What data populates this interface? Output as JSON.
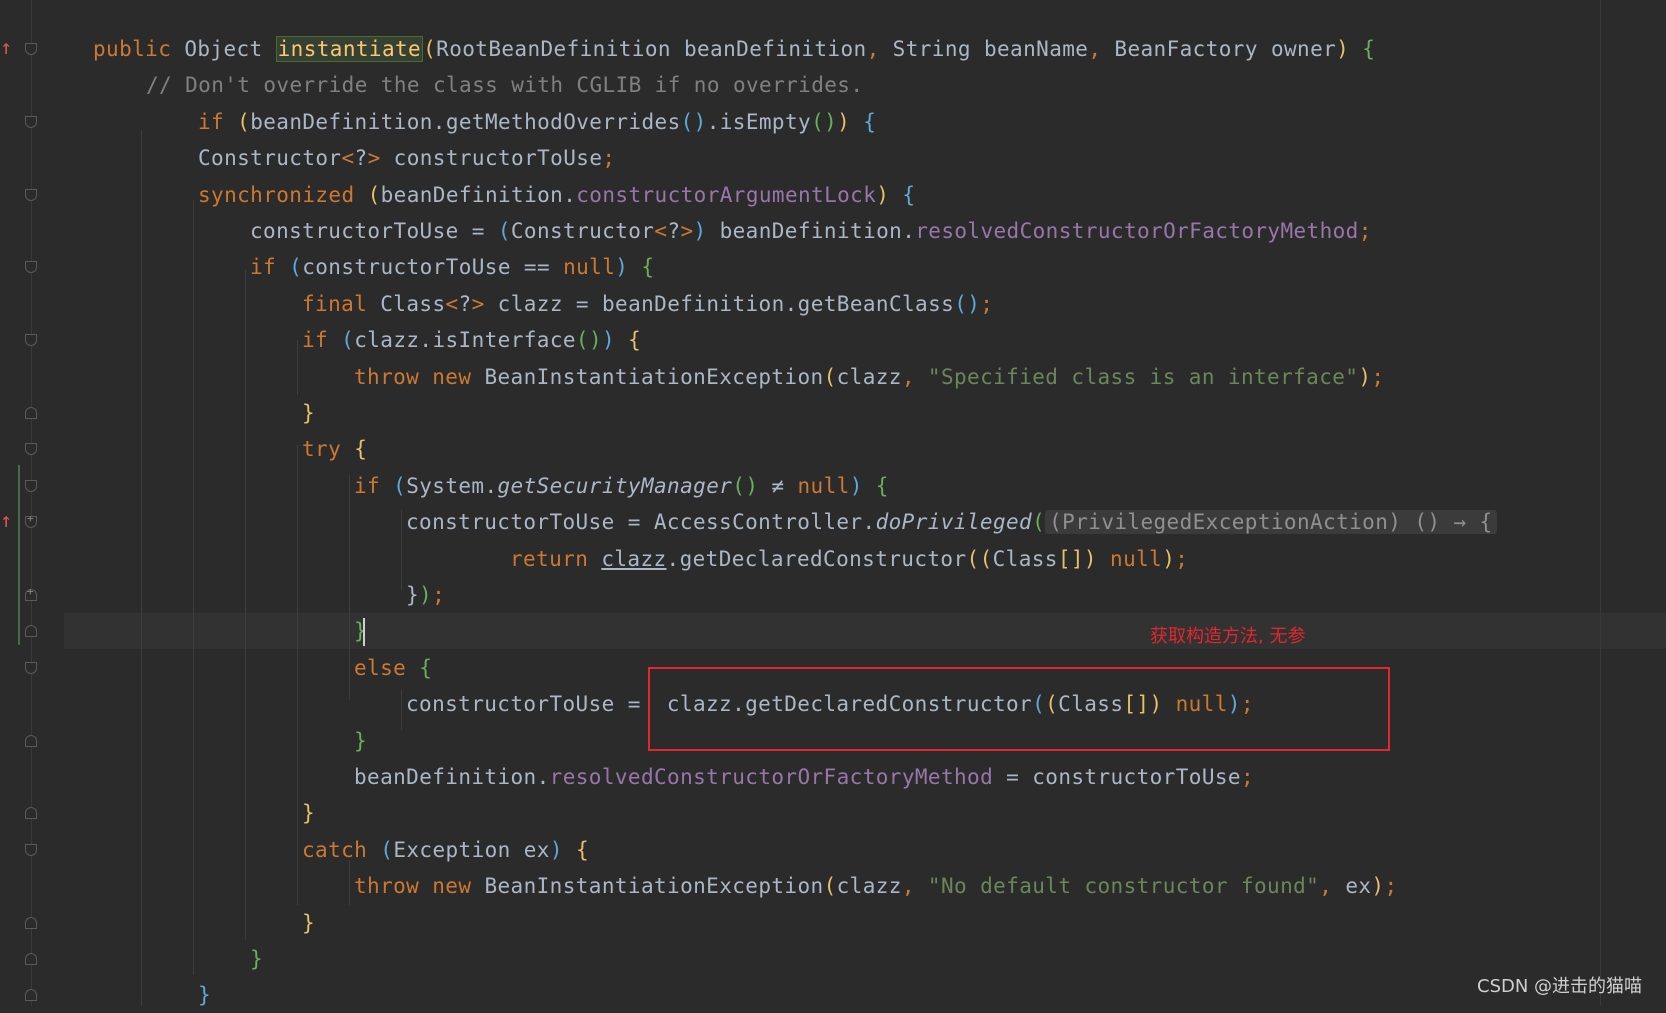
{
  "code_lines": [
    [
      {
        "c": "kw",
        "t": "public "
      },
      {
        "t": "Object "
      },
      {
        "c": "hl",
        "t": "instantiate"
      },
      {
        "c": "b1",
        "t": "("
      },
      {
        "t": "RootBeanDefinition beanDefinition"
      },
      {
        "c": "kw",
        "t": ", "
      },
      {
        "t": "String beanName"
      },
      {
        "c": "kw",
        "t": ", "
      },
      {
        "t": "BeanFactory owner"
      },
      {
        "c": "b1",
        "t": ")"
      },
      {
        "t": " "
      },
      {
        "c": "b3",
        "t": "{"
      }
    ],
    [
      {
        "c": "cmt",
        "t": "// Don't override the class with CGLIB if no overrides."
      }
    ],
    [
      {
        "c": "kw",
        "t": "if "
      },
      {
        "c": "b1",
        "t": "("
      },
      {
        "t": "beanDefinition.getMethodOverrides"
      },
      {
        "c": "b2",
        "t": "()"
      },
      {
        "t": ".isEmpty"
      },
      {
        "c": "b3",
        "t": "()"
      },
      {
        "c": "b1",
        "t": ")"
      },
      {
        "t": " "
      },
      {
        "c": "b2",
        "t": "{"
      }
    ],
    [
      {
        "t": "Constructor"
      },
      {
        "c": "kw",
        "t": "<"
      },
      {
        "t": "?"
      },
      {
        "c": "kw",
        "t": ">"
      },
      {
        "t": " constructorToUse"
      },
      {
        "c": "kw",
        "t": ";"
      }
    ],
    [
      {
        "c": "kw",
        "t": "synchronized "
      },
      {
        "c": "b1",
        "t": "("
      },
      {
        "t": "beanDefinition."
      },
      {
        "c": "fld",
        "t": "constructorArgumentLock"
      },
      {
        "c": "b1",
        "t": ")"
      },
      {
        "t": " "
      },
      {
        "c": "b2",
        "t": "{"
      }
    ],
    [
      {
        "t": "constructorToUse = "
      },
      {
        "c": "b2",
        "t": "("
      },
      {
        "t": "Constructor"
      },
      {
        "c": "kw",
        "t": "<"
      },
      {
        "t": "?"
      },
      {
        "c": "kw",
        "t": ">"
      },
      {
        "c": "b2",
        "t": ")"
      },
      {
        "t": " beanDefinition."
      },
      {
        "c": "fld",
        "t": "resolvedConstructorOrFactoryMethod"
      },
      {
        "c": "kw",
        "t": ";"
      }
    ],
    [
      {
        "c": "kw",
        "t": "if "
      },
      {
        "c": "b2",
        "t": "("
      },
      {
        "t": "constructorToUse == "
      },
      {
        "c": "kw",
        "t": "null"
      },
      {
        "c": "b2",
        "t": ")"
      },
      {
        "t": " "
      },
      {
        "c": "b3",
        "t": "{"
      }
    ],
    [
      {
        "c": "kw",
        "t": "final "
      },
      {
        "t": "Class"
      },
      {
        "c": "kw",
        "t": "<"
      },
      {
        "t": "?"
      },
      {
        "c": "kw",
        "t": ">"
      },
      {
        "t": " clazz = beanDefinition.getBeanClass"
      },
      {
        "c": "b2",
        "t": "()"
      },
      {
        "c": "kw",
        "t": ";"
      }
    ],
    [
      {
        "c": "kw",
        "t": "if "
      },
      {
        "c": "b2",
        "t": "("
      },
      {
        "t": "clazz.isInterface"
      },
      {
        "c": "b3",
        "t": "()"
      },
      {
        "c": "b2",
        "t": ")"
      },
      {
        "t": " "
      },
      {
        "c": "b1",
        "t": "{"
      }
    ],
    [
      {
        "c": "kw",
        "t": "throw new "
      },
      {
        "t": "BeanInstantiationException"
      },
      {
        "c": "b1",
        "t": "("
      },
      {
        "t": "clazz"
      },
      {
        "c": "kw",
        "t": ", "
      },
      {
        "c": "str",
        "t": "\"Specified class is an interface\""
      },
      {
        "c": "b1",
        "t": ")"
      },
      {
        "c": "kw",
        "t": ";"
      }
    ],
    [
      {
        "c": "b1",
        "t": "}"
      }
    ],
    [
      {
        "c": "kw",
        "t": "try "
      },
      {
        "c": "b1",
        "t": "{"
      }
    ],
    [
      {
        "c": "kw",
        "t": "if "
      },
      {
        "c": "b2",
        "t": "("
      },
      {
        "t": "System."
      },
      {
        "c": "it",
        "t": "getSecurityManager"
      },
      {
        "c": "b3",
        "t": "()"
      },
      {
        "t": " ≠ "
      },
      {
        "c": "kw",
        "t": "null"
      },
      {
        "c": "b2",
        "t": ")"
      },
      {
        "t": " "
      },
      {
        "c": "b3",
        "t": "{"
      }
    ],
    [
      {
        "t": "constructorToUse = AccessController."
      },
      {
        "c": "it",
        "t": "doPrivileged"
      },
      {
        "c": "b3",
        "t": "("
      },
      {
        "c": "hint",
        "t": "(PrivilegedExceptionAction) () → {"
      }
    ],
    [
      {
        "c": "kw",
        "t": "return "
      },
      {
        "c": "ul",
        "t": "clazz"
      },
      {
        "t": ".getDeclaredConstructor"
      },
      {
        "c": "b1",
        "t": "(("
      },
      {
        "t": "Class"
      },
      {
        "c": "b1",
        "t": "[])"
      },
      {
        "t": " "
      },
      {
        "c": "kw",
        "t": "null"
      },
      {
        "c": "b1",
        "t": ")"
      },
      {
        "c": "kw",
        "t": ";"
      }
    ],
    [
      {
        "t": "}"
      },
      {
        "c": "b3",
        "t": ")"
      },
      {
        "c": "kw",
        "t": ";"
      }
    ],
    [
      {
        "c": "b3",
        "t": "}"
      }
    ],
    [
      {
        "c": "kw",
        "t": "else "
      },
      {
        "c": "b3",
        "t": "{"
      }
    ],
    [
      {
        "t": "constructorToUse =  clazz.getDeclaredConstructor"
      },
      {
        "c": "b2",
        "t": "("
      },
      {
        "c": "b1",
        "t": "("
      },
      {
        "t": "Class"
      },
      {
        "c": "b1",
        "t": "[])"
      },
      {
        "t": " "
      },
      {
        "c": "kw",
        "t": "null"
      },
      {
        "c": "b2",
        "t": ")"
      },
      {
        "c": "kw",
        "t": ";"
      }
    ],
    [
      {
        "c": "b3",
        "t": "}"
      }
    ],
    [
      {
        "t": "beanDefinition."
      },
      {
        "c": "fld",
        "t": "resolvedConstructorOrFactoryMethod"
      },
      {
        "t": " = constructorToUse"
      },
      {
        "c": "kw",
        "t": ";"
      }
    ],
    [
      {
        "c": "b1",
        "t": "}"
      }
    ],
    [
      {
        "c": "kw",
        "t": "catch "
      },
      {
        "c": "b2",
        "t": "("
      },
      {
        "t": "Exception ex"
      },
      {
        "c": "b2",
        "t": ")"
      },
      {
        "t": " "
      },
      {
        "c": "b1",
        "t": "{"
      }
    ],
    [
      {
        "c": "kw",
        "t": "throw new "
      },
      {
        "t": "BeanInstantiationException"
      },
      {
        "c": "b1",
        "t": "("
      },
      {
        "t": "clazz"
      },
      {
        "c": "kw",
        "t": ", "
      },
      {
        "c": "str",
        "t": "\"No default constructor found\""
      },
      {
        "c": "kw",
        "t": ", "
      },
      {
        "t": "ex"
      },
      {
        "c": "b1",
        "t": ")"
      },
      {
        "c": "kw",
        "t": ";"
      }
    ],
    [
      {
        "c": "b1",
        "t": "}"
      }
    ],
    [
      {
        "c": "b3",
        "t": "}"
      }
    ],
    [
      {
        "c": "b2",
        "t": "}"
      }
    ]
  ],
  "annotation": "获取构造方法, 无参",
  "watermark": "CSDN @进击的猫喵",
  "colors": {
    "background": "#2b2b2b",
    "keyword": "#cc7832",
    "string": "#6a8759",
    "comment": "#808080",
    "field": "#9876aa",
    "default_text": "#a9b7c6",
    "highlight_box": "#e0282e"
  }
}
